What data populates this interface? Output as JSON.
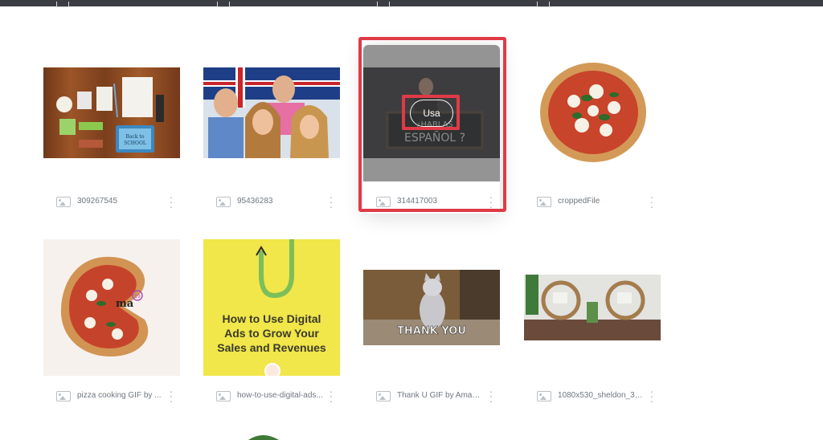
{
  "colors": {
    "accent_highlight": "#e03a47",
    "meta_text": "#6f7780",
    "topbar": "#3a3d42",
    "overlay": "rgba(60,60,60,0.55)"
  },
  "hover": {
    "use_label": "Usa"
  },
  "assets": [
    {
      "name": "309267545",
      "icon": "image-icon",
      "scene": "back-to-school desk",
      "thumb_text": "Back to SCHOOL"
    },
    {
      "name": "95436283",
      "icon": "image-icon",
      "scene": "four friends with uk flag"
    },
    {
      "name": "314417003",
      "icon": "image-icon",
      "scene": "espanol chalkboard",
      "thumb_text": "¿HABLAS ESPAÑOL?"
    },
    {
      "name": "croppedFile",
      "icon": "image-icon",
      "scene": "pizza margherita"
    },
    {
      "name": "pizza cooking GIF by ...",
      "icon": "image-icon",
      "scene": "pizza cooking gif",
      "thumb_text": "ma",
      "badge": "19"
    },
    {
      "name": "how-to-use-digital-ads...",
      "icon": "image-icon",
      "scene": "digital ads cover",
      "thumb_text": "How to Use Digital Ads to Grow Your Sales and Revenues"
    },
    {
      "name": "Thank U GIF by Amanda",
      "icon": "image-icon",
      "scene": "cat gif",
      "thumb_text": "THANK YOU"
    },
    {
      "name": "1080x530_sheldon_3p...",
      "icon": "image-icon",
      "scene": "patio rattan chairs"
    }
  ]
}
